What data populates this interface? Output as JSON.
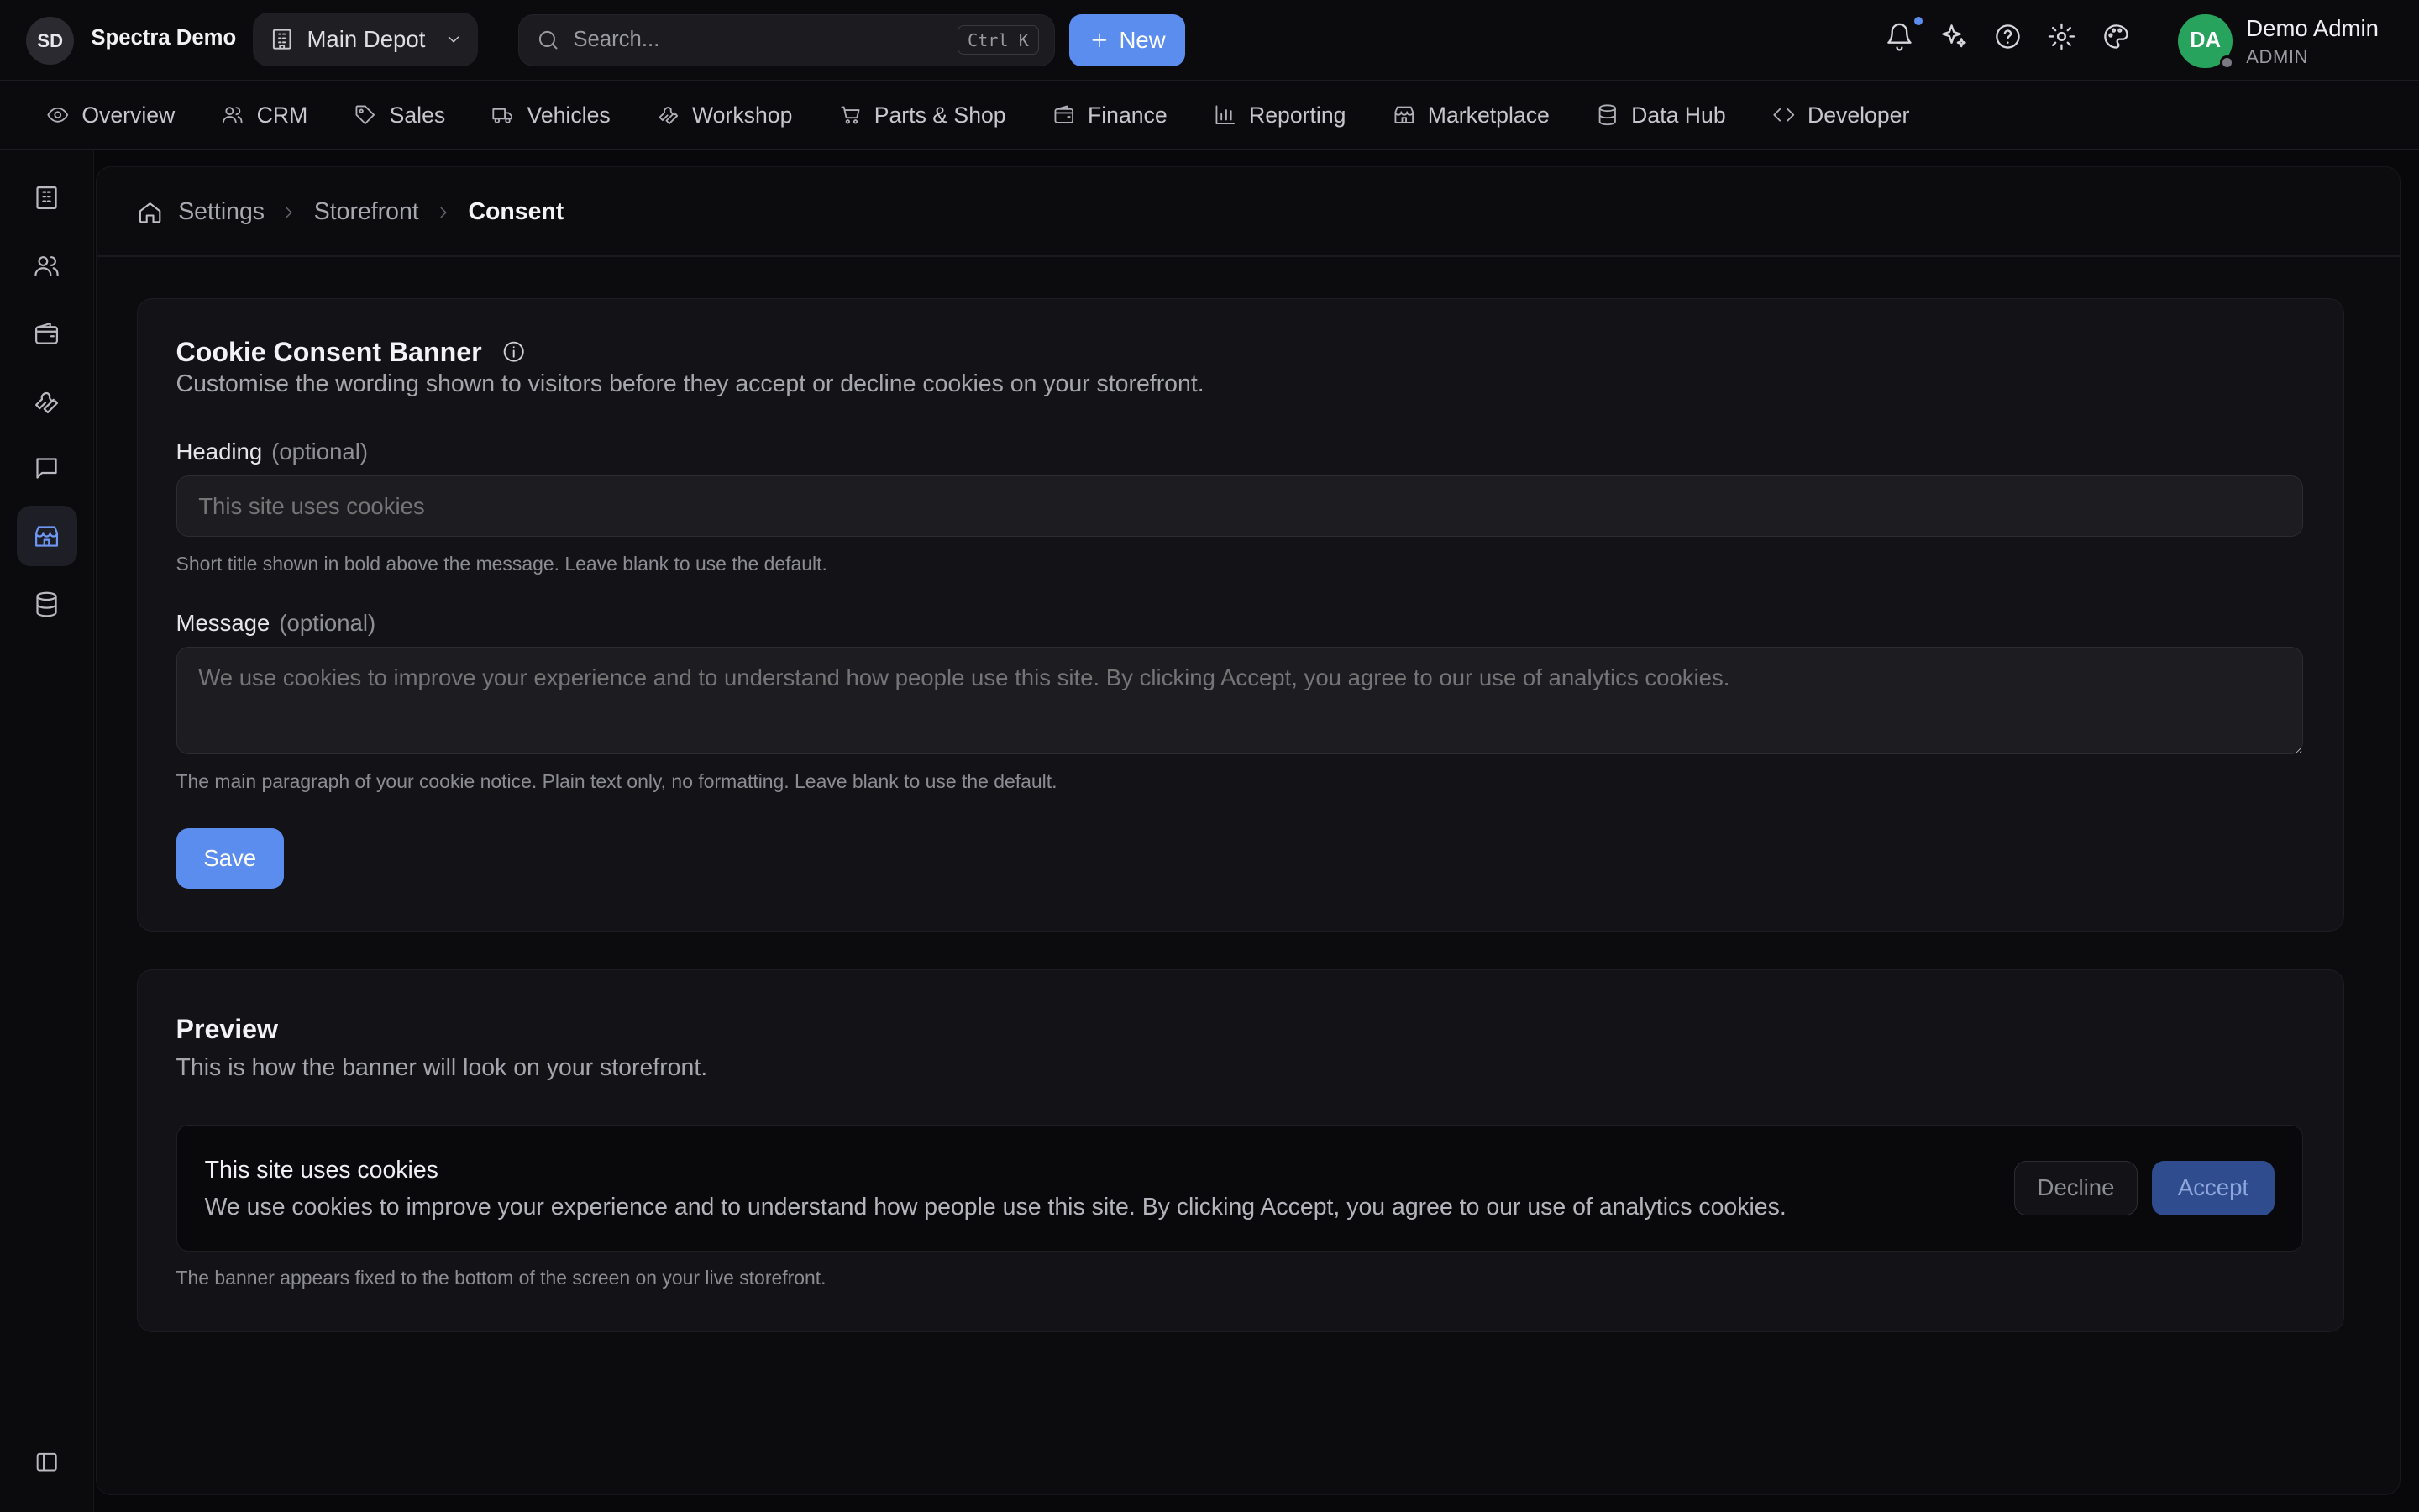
{
  "app": {
    "badge": "SD",
    "name": "Spectra Demo",
    "depot": "Main Depot",
    "search_placeholder": "Search...",
    "search_shortcut": "Ctrl K",
    "new_label": "New"
  },
  "user": {
    "initials": "DA",
    "name": "Demo Admin",
    "role": "ADMIN",
    "avatar_color": "#27a35d"
  },
  "accent_color": "#5b8def",
  "nav": [
    {
      "label": "Overview",
      "icon": "eye-icon"
    },
    {
      "label": "CRM",
      "icon": "users-icon"
    },
    {
      "label": "Sales",
      "icon": "tag-icon"
    },
    {
      "label": "Vehicles",
      "icon": "truck-icon"
    },
    {
      "label": "Workshop",
      "icon": "wrench-icon"
    },
    {
      "label": "Parts & Shop",
      "icon": "cart-icon"
    },
    {
      "label": "Finance",
      "icon": "wallet-icon"
    },
    {
      "label": "Reporting",
      "icon": "bar-chart-icon"
    },
    {
      "label": "Marketplace",
      "icon": "store-icon"
    },
    {
      "label": "Data Hub",
      "icon": "database-icon"
    },
    {
      "label": "Developer",
      "icon": "code-icon"
    }
  ],
  "sidebar": {
    "items": [
      "building-icon",
      "users-icon",
      "wallet-icon",
      "wrench-icon",
      "message-icon",
      "store-icon",
      "database-icon"
    ],
    "active": "store-icon"
  },
  "breadcrumb": [
    "Settings",
    "Storefront",
    "Consent"
  ],
  "consent": {
    "title": "Cookie Consent Banner",
    "subtitle": "Customise the wording shown to visitors before they accept or decline cookies on your storefront.",
    "heading_label": "Heading",
    "heading_optional": "(optional)",
    "heading_placeholder": "This site uses cookies",
    "heading_hint": "Short title shown in bold above the message. Leave blank to use the default.",
    "message_label": "Message",
    "message_optional": "(optional)",
    "message_placeholder": "We use cookies to improve your experience and to understand how people use this site. By clicking Accept, you agree to our use of analytics cookies.",
    "message_hint": "The main paragraph of your cookie notice. Plain text only, no formatting. Leave blank to use the default.",
    "save_label": "Save"
  },
  "preview": {
    "title": "Preview",
    "subtitle": "This is how the banner will look on your storefront.",
    "banner_heading": "This site uses cookies",
    "banner_message": "We use cookies to improve your experience and to understand how people use this site. By clicking Accept, you agree to our use of analytics cookies.",
    "decline_label": "Decline",
    "accept_label": "Accept",
    "footnote": "The banner appears fixed to the bottom of the screen on your live storefront."
  }
}
